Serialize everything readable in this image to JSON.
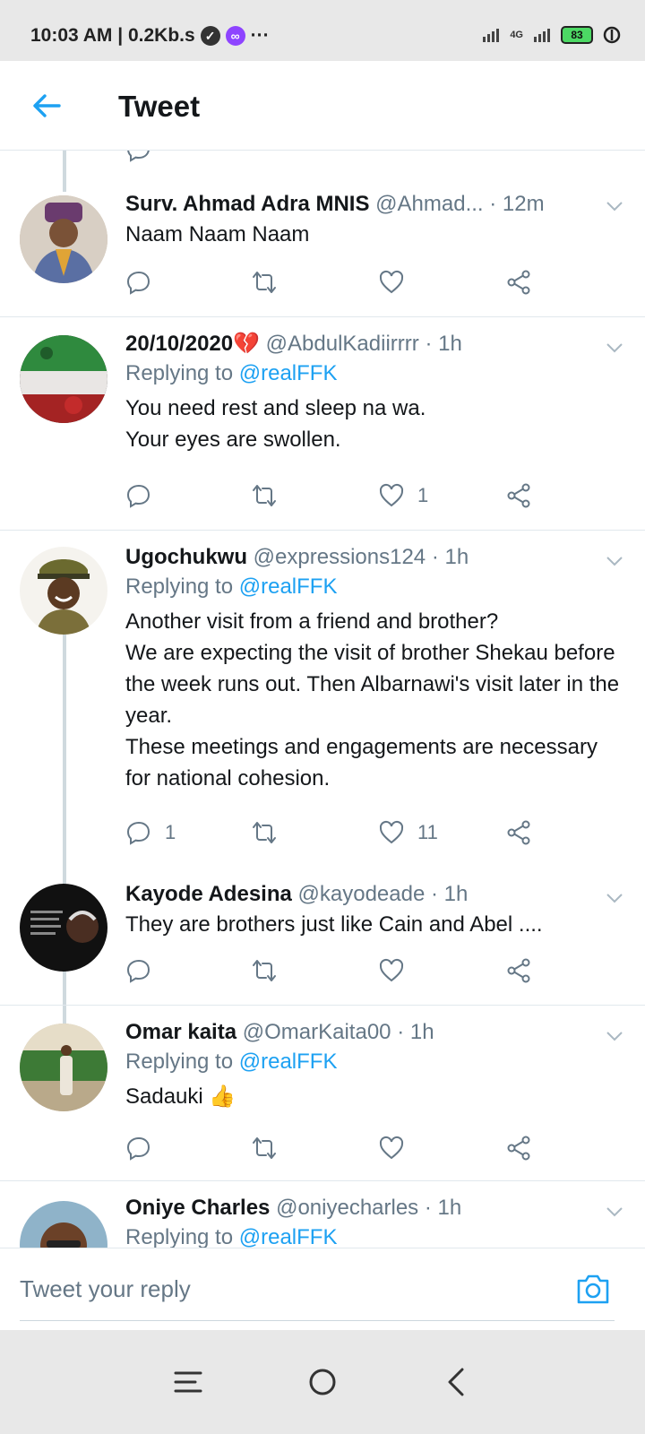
{
  "status_bar": {
    "time_speed": "10:03 AM | 0.2Kb.s",
    "more": "···",
    "network": "4G",
    "battery": "83"
  },
  "header": {
    "title": "Tweet"
  },
  "tweets": [
    {
      "name": "Surv. Ahmad Adra MNIS",
      "handle": "@Ahmad...",
      "time": "· 12m",
      "text": "Naam Naam Naam",
      "replies": "",
      "retweets": "",
      "likes": ""
    },
    {
      "name": "20/10/2020💔",
      "handle": "@AbdulKadiirrrr",
      "time": "· 1h",
      "replying_prefix": "Replying to ",
      "replying_to": "@realFFK",
      "text": "You need rest and sleep na wa.\nYour eyes are swollen.",
      "replies": "",
      "retweets": "",
      "likes": "1"
    },
    {
      "name": "Ugochukwu",
      "handle": "@expressions124",
      "time": "· 1h",
      "replying_prefix": "Replying to ",
      "replying_to": "@realFFK",
      "text": "Another visit from a friend and brother?\nWe are expecting the visit of brother Shekau before the week runs out. Then Albarnawi's visit later in the year.\nThese meetings and engagements are necessary for national cohesion.",
      "replies": "1",
      "retweets": "",
      "likes": "11"
    },
    {
      "name": "Kayode Adesina",
      "handle": "@kayodeade",
      "time": "· 1h",
      "text": "They are brothers just like Cain and Abel ....",
      "replies": "",
      "retweets": "",
      "likes": ""
    },
    {
      "name": "Omar kaita",
      "handle": "@OmarKaita00",
      "time": "· 1h",
      "replying_prefix": "Replying to ",
      "replying_to": "@realFFK",
      "text": "Sadauki 👍",
      "replies": "",
      "retweets": "",
      "likes": ""
    },
    {
      "name": "Oniye Charles",
      "handle": "@oniyecharles",
      "time": "· 1h",
      "replying_prefix": "Replying to ",
      "replying_to": "@realFFK"
    }
  ],
  "reply": {
    "placeholder": "Tweet your reply"
  },
  "colors": {
    "accent": "#1da1f2",
    "secondary_text": "#657786",
    "divider": "#e1e8ed"
  },
  "icons": {
    "reply": "reply-icon",
    "retweet": "retweet-icon",
    "like": "heart-icon",
    "share": "share-icon",
    "caret": "chevron-down-icon",
    "camera": "camera-icon"
  }
}
